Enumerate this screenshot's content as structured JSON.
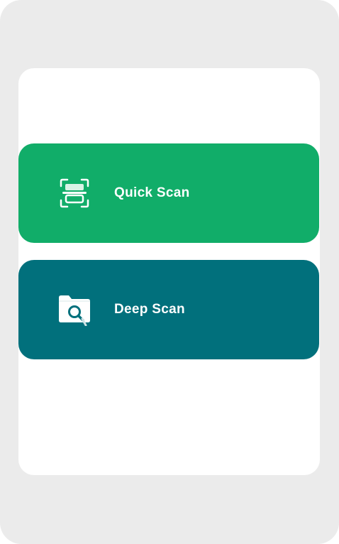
{
  "colors": {
    "quick_scan_bg": "#11ad69",
    "deep_scan_bg": "#01707c",
    "device_bg": "#ebebeb",
    "panel_bg": "#ffffff"
  },
  "buttons": {
    "quick_scan": {
      "label": "Quick Scan",
      "icon": "scanner-icon"
    },
    "deep_scan": {
      "label": "Deep Scan",
      "icon": "folder-search-icon"
    }
  }
}
